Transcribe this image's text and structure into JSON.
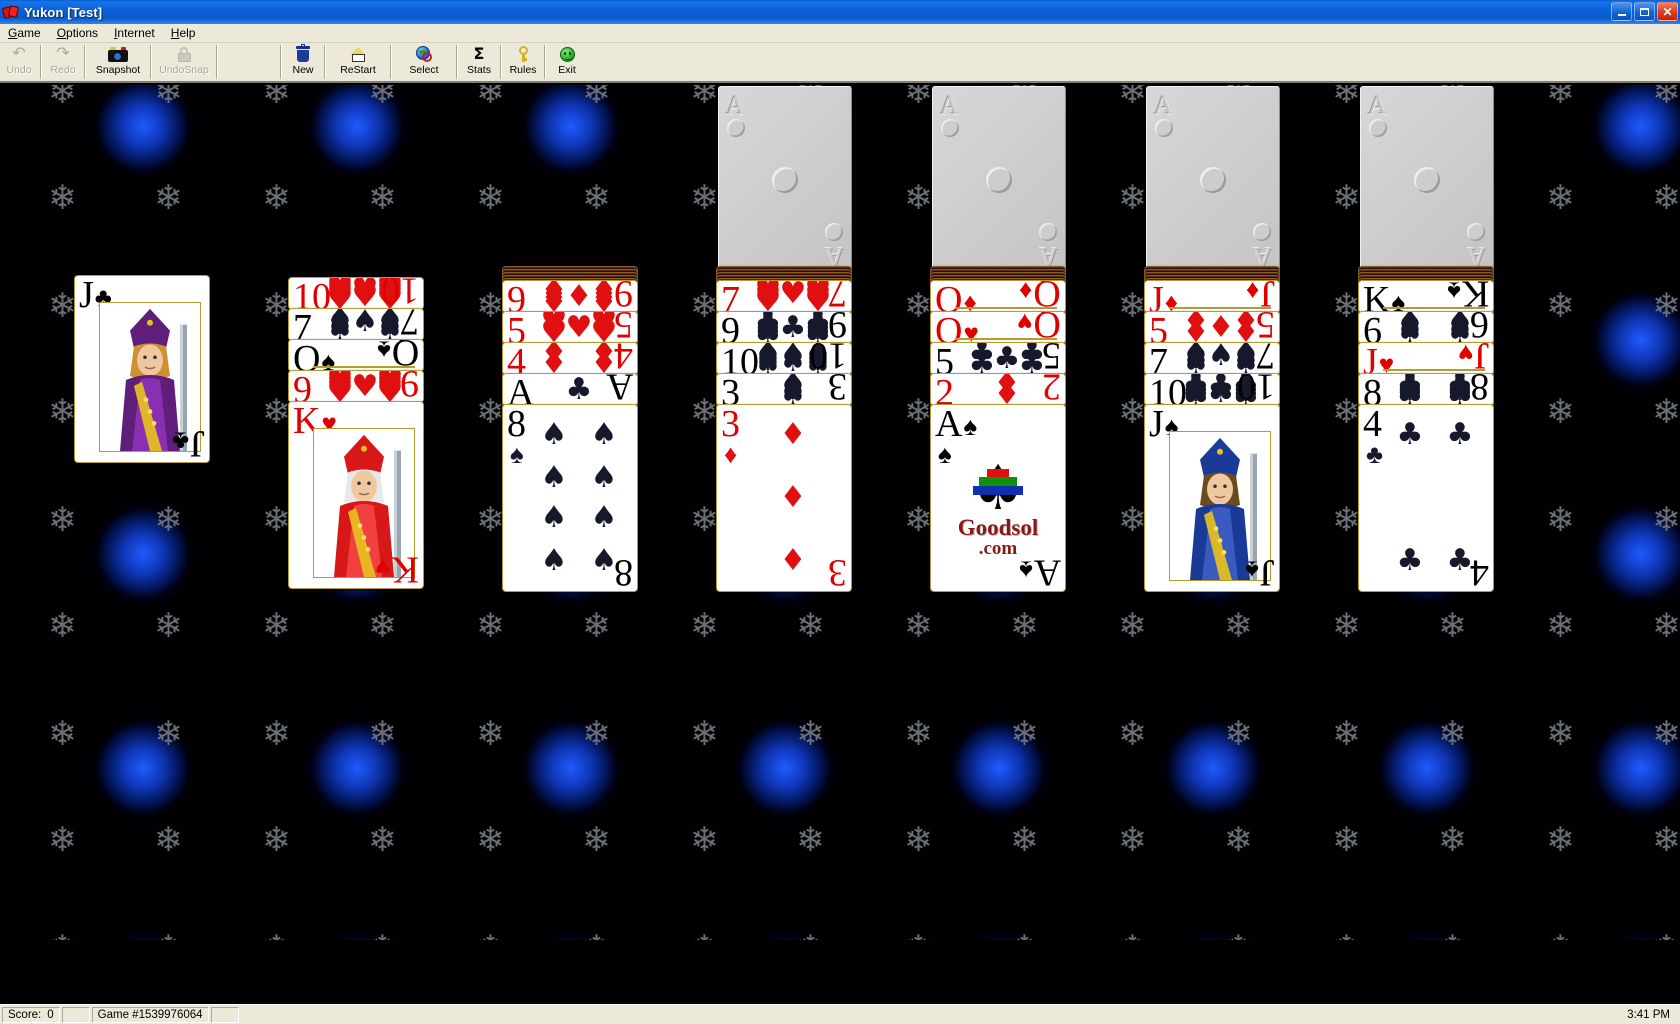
{
  "window": {
    "title": "Yukon [Test]",
    "icon": "cards-icon",
    "buttons": {
      "minimize": "minimize-button",
      "maximize": "maximize-button",
      "close": "close-button"
    }
  },
  "menu": {
    "items": [
      {
        "label": "Game",
        "accel": "G"
      },
      {
        "label": "Options",
        "accel": "O"
      },
      {
        "label": "Internet",
        "accel": "I"
      },
      {
        "label": "Help",
        "accel": "H"
      }
    ]
  },
  "toolbar": {
    "buttons": [
      {
        "label": "Undo",
        "icon": "undo-arrow-icon",
        "enabled": false
      },
      {
        "label": "Redo",
        "icon": "redo-arrow-icon",
        "enabled": false
      },
      {
        "label": "Snapshot",
        "icon": "camera-icon",
        "enabled": true
      },
      {
        "label": "UndoSnap",
        "icon": "lock-icon",
        "enabled": false
      },
      {
        "label": "New",
        "icon": "trash-can-icon",
        "enabled": true
      },
      {
        "label": "ReStart",
        "icon": "house-icon",
        "enabled": true
      },
      {
        "label": "Select",
        "icon": "globe-search-icon",
        "enabled": true
      },
      {
        "label": "Stats",
        "icon": "sigma-icon",
        "enabled": true
      },
      {
        "label": "Rules",
        "icon": "key-icon",
        "enabled": true
      },
      {
        "label": "Exit",
        "icon": "smiley-icon",
        "enabled": true
      }
    ]
  },
  "statusbar": {
    "score_label": "Score:",
    "score_value": "0",
    "game_id": "Game #1539976064",
    "clock": "3:41 PM"
  },
  "board": {
    "game_name": "Yukon",
    "foundations": [
      {
        "name": "foundation-1",
        "placeholder_rank": "A",
        "placeholder_pip": "circle",
        "empty": true
      },
      {
        "name": "foundation-2",
        "placeholder_rank": "A",
        "placeholder_pip": "circle",
        "empty": true
      },
      {
        "name": "foundation-3",
        "placeholder_rank": "A",
        "placeholder_pip": "circle",
        "empty": true
      },
      {
        "name": "foundation-4",
        "placeholder_rank": "A",
        "placeholder_pip": "circle",
        "empty": true
      }
    ],
    "tableau": [
      {
        "name": "tableau-column-1",
        "facedown": 0,
        "cards": [
          {
            "rank": "J",
            "suit": "clubs",
            "color": "black",
            "court": true,
            "facedown": false
          }
        ]
      },
      {
        "name": "tableau-column-2",
        "facedown": 0,
        "cards": [
          {
            "rank": "10",
            "suit": "hearts",
            "color": "red",
            "court": false,
            "facedown": false
          },
          {
            "rank": "7",
            "suit": "spades",
            "color": "black",
            "court": false,
            "facedown": false
          },
          {
            "rank": "Q",
            "suit": "spades",
            "color": "black",
            "court": true,
            "facedown": false
          },
          {
            "rank": "9",
            "suit": "hearts",
            "color": "red",
            "court": false,
            "facedown": false
          },
          {
            "rank": "K",
            "suit": "hearts",
            "color": "red",
            "court": true,
            "facedown": false
          }
        ]
      },
      {
        "name": "tableau-column-3",
        "facedown": 1,
        "cards": [
          {
            "rank": "9",
            "suit": "diamonds",
            "color": "red",
            "court": false,
            "facedown": false
          },
          {
            "rank": "5",
            "suit": "hearts",
            "color": "red",
            "court": false,
            "facedown": false
          },
          {
            "rank": "4",
            "suit": "diamonds",
            "color": "red",
            "court": false,
            "facedown": false
          },
          {
            "rank": "A",
            "suit": "clubs",
            "color": "black",
            "court": false,
            "facedown": false
          },
          {
            "rank": "8",
            "suit": "spades",
            "color": "black",
            "court": false,
            "facedown": false
          }
        ]
      },
      {
        "name": "tableau-column-4",
        "facedown": 1,
        "cards": [
          {
            "rank": "7",
            "suit": "hearts",
            "color": "red",
            "court": false,
            "facedown": false
          },
          {
            "rank": "9",
            "suit": "clubs",
            "color": "black",
            "court": false,
            "facedown": false
          },
          {
            "rank": "10",
            "suit": "spades",
            "color": "black",
            "court": false,
            "facedown": false
          },
          {
            "rank": "3",
            "suit": "spades",
            "color": "black",
            "court": false,
            "facedown": false
          },
          {
            "rank": "3",
            "suit": "diamonds",
            "color": "red",
            "court": false,
            "facedown": false
          }
        ]
      },
      {
        "name": "tableau-column-5",
        "facedown": 1,
        "cards": [
          {
            "rank": "Q",
            "suit": "diamonds",
            "color": "red",
            "court": true,
            "facedown": false
          },
          {
            "rank": "Q",
            "suit": "hearts",
            "color": "red",
            "court": true,
            "facedown": false
          },
          {
            "rank": "5",
            "suit": "clubs",
            "color": "black",
            "court": false,
            "facedown": false
          },
          {
            "rank": "2",
            "suit": "diamonds",
            "color": "red",
            "court": false,
            "facedown": false
          },
          {
            "rank": "A",
            "suit": "spades",
            "color": "black",
            "court": false,
            "facedown": false,
            "logo": "Goodsol.com"
          }
        ]
      },
      {
        "name": "tableau-column-6",
        "facedown": 1,
        "cards": [
          {
            "rank": "J",
            "suit": "diamonds",
            "color": "red",
            "court": true,
            "facedown": false
          },
          {
            "rank": "5",
            "suit": "diamonds",
            "color": "red",
            "court": false,
            "facedown": false
          },
          {
            "rank": "7",
            "suit": "spades",
            "color": "black",
            "court": false,
            "facedown": false
          },
          {
            "rank": "10",
            "suit": "clubs",
            "color": "black",
            "court": false,
            "facedown": false
          },
          {
            "rank": "J",
            "suit": "spades",
            "color": "black",
            "court": true,
            "facedown": false
          }
        ]
      },
      {
        "name": "tableau-column-7",
        "facedown": 1,
        "cards": [
          {
            "rank": "K",
            "suit": "spades",
            "color": "black",
            "court": true,
            "facedown": false
          },
          {
            "rank": "6",
            "suit": "spades",
            "color": "black",
            "court": false,
            "facedown": false
          },
          {
            "rank": "J",
            "suit": "hearts",
            "color": "red",
            "court": true,
            "facedown": false
          },
          {
            "rank": "8",
            "suit": "clubs",
            "color": "black",
            "court": false,
            "facedown": false
          },
          {
            "rank": "4",
            "suit": "clubs",
            "color": "black",
            "court": false,
            "facedown": false
          }
        ]
      }
    ]
  },
  "colors": {
    "titlebar": "#0a58c8",
    "chrome": "#ece9d8",
    "felt_dark": "#000000",
    "felt_blue": "#1f5bff",
    "card_red": "#e00000",
    "card_black": "#000000",
    "card_border": "#b89a2e",
    "goodsol_red": "#8a1818"
  }
}
